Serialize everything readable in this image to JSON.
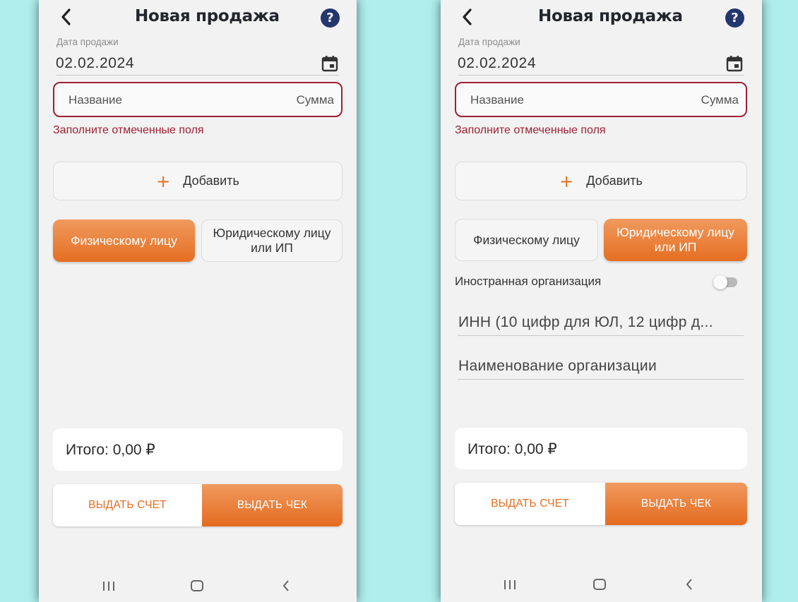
{
  "screens": [
    {
      "title": "Новая продажа",
      "help_icon": "?",
      "date_label": "Дата продажи",
      "date_value": "02.02.2024",
      "item_name_placeholder": "Название",
      "item_sum_placeholder": "Сумма",
      "error": "Заполните отмеченные поля",
      "add_label": "Добавить",
      "add_icon": "+",
      "segment_individual": "Физическому лицу",
      "segment_legal": "Юридическому лицу или ИП",
      "active_segment": "individual",
      "total": "Итого: 0,00 ₽",
      "invoice_button": "ВЫДАТЬ СЧЕТ",
      "receipt_button": "ВЫДАТЬ ЧЕК"
    },
    {
      "title": "Новая продажа",
      "help_icon": "?",
      "date_label": "Дата продажи",
      "date_value": "02.02.2024",
      "item_name_placeholder": "Название",
      "item_sum_placeholder": "Сумма",
      "error": "Заполните отмеченные поля",
      "add_label": "Добавить",
      "add_icon": "+",
      "segment_individual": "Физическому лицу",
      "segment_legal": "Юридическому лицу или ИП",
      "active_segment": "legal",
      "foreign_org_label": "Иностранная организация",
      "foreign_org_on": false,
      "inn_placeholder": "ИНН (10 цифр для ЮЛ, 12 цифр д...",
      "org_name_placeholder": "Наименование организации",
      "total": "Итого: 0,00 ₽",
      "invoice_button": "ВЫДАТЬ СЧЕТ",
      "receipt_button": "ВЫДАТЬ ЧЕК"
    }
  ],
  "colors": {
    "background": "#aeeeed",
    "accent": "#e56e22",
    "error": "#9e1f33",
    "help_icon_bg": "#23366e"
  },
  "icons": {
    "back": "chevron-left-icon",
    "help": "help-icon",
    "calendar": "calendar-icon",
    "nav_recent": "recent-apps-icon",
    "nav_home": "home-icon",
    "nav_back": "nav-back-icon"
  }
}
